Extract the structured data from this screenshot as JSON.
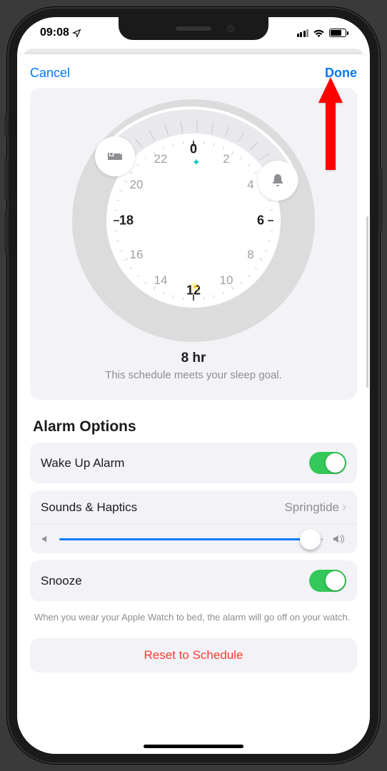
{
  "status": {
    "time": "09:08"
  },
  "nav": {
    "cancel": "Cancel",
    "done": "Done"
  },
  "dial": {
    "hours": [
      "0",
      "2",
      "4",
      "6",
      "8",
      "10",
      "12",
      "14",
      "16",
      "18",
      "20",
      "22"
    ],
    "bold_hours": [
      "0",
      "6",
      "12",
      "18"
    ],
    "duration": "8 hr",
    "goal_text": "This schedule meets your sleep goal."
  },
  "alarm": {
    "section_title": "Alarm Options",
    "wake_label": "Wake Up Alarm",
    "wake_on": true,
    "sounds_label": "Sounds & Haptics",
    "sounds_value": "Springtide",
    "snooze_label": "Snooze",
    "snooze_on": true,
    "footnote": "When you wear your Apple Watch to bed, the alarm will go off on your watch."
  },
  "reset": {
    "label": "Reset to Schedule"
  }
}
